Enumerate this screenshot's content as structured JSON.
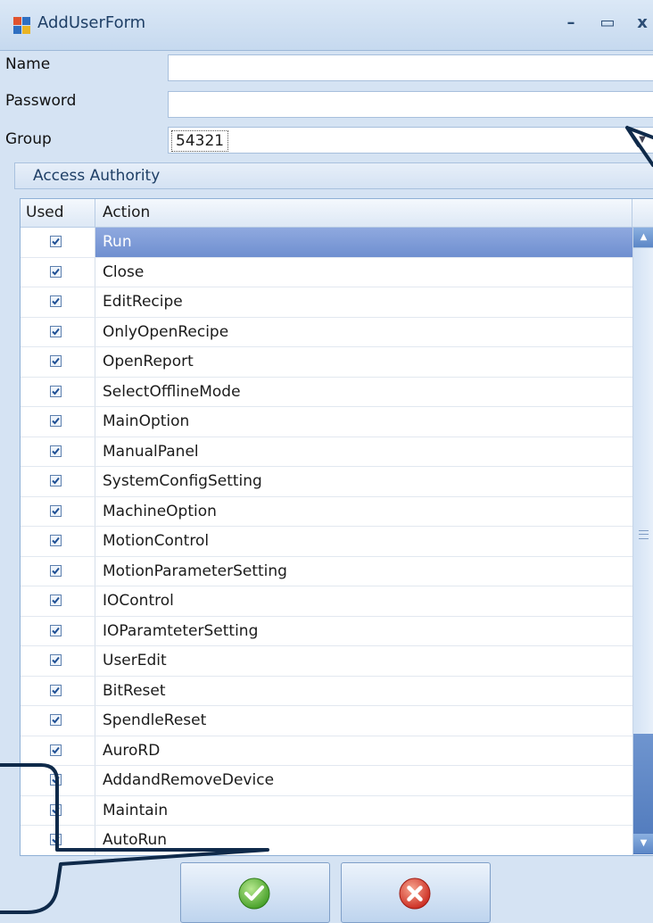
{
  "window": {
    "title": "AddUserForm",
    "minimize_glyph": "–",
    "maximize_glyph": "▭",
    "close_glyph": "x"
  },
  "form": {
    "name_label": "Name",
    "name_value": "",
    "password_label": "Password",
    "password_value": "",
    "group_label": "Group",
    "group_value": "54321"
  },
  "access": {
    "group_title": "Access Authority",
    "columns": [
      "Used",
      "Action"
    ],
    "rows": [
      {
        "used": true,
        "action": "Run",
        "selected": true
      },
      {
        "used": true,
        "action": "Close"
      },
      {
        "used": true,
        "action": "EditRecipe"
      },
      {
        "used": true,
        "action": "OnlyOpenRecipe"
      },
      {
        "used": true,
        "action": "OpenReport"
      },
      {
        "used": true,
        "action": "SelectOfflineMode"
      },
      {
        "used": true,
        "action": "MainOption"
      },
      {
        "used": true,
        "action": "ManualPanel"
      },
      {
        "used": true,
        "action": "SystemConfigSetting"
      },
      {
        "used": true,
        "action": "MachineOption"
      },
      {
        "used": true,
        "action": "MotionControl"
      },
      {
        "used": true,
        "action": "MotionParameterSetting"
      },
      {
        "used": true,
        "action": "IOControl"
      },
      {
        "used": true,
        "action": "IOParamteterSetting"
      },
      {
        "used": true,
        "action": "UserEdit"
      },
      {
        "used": true,
        "action": "BitReset"
      },
      {
        "used": true,
        "action": "SpendleReset"
      },
      {
        "used": true,
        "action": "AuroRD"
      },
      {
        "used": true,
        "action": "AddandRemoveDevice"
      },
      {
        "used": true,
        "action": "Maintain"
      },
      {
        "used": true,
        "action": "AutoRun"
      }
    ]
  },
  "buttons": {
    "ok_icon": "green-checkmark-icon",
    "cancel_icon": "red-x-icon"
  },
  "colors": {
    "selection": "#7a97d6",
    "ok_green": "#4fa62c",
    "cancel_red": "#d9342a",
    "callout": "#0f2a4a"
  }
}
